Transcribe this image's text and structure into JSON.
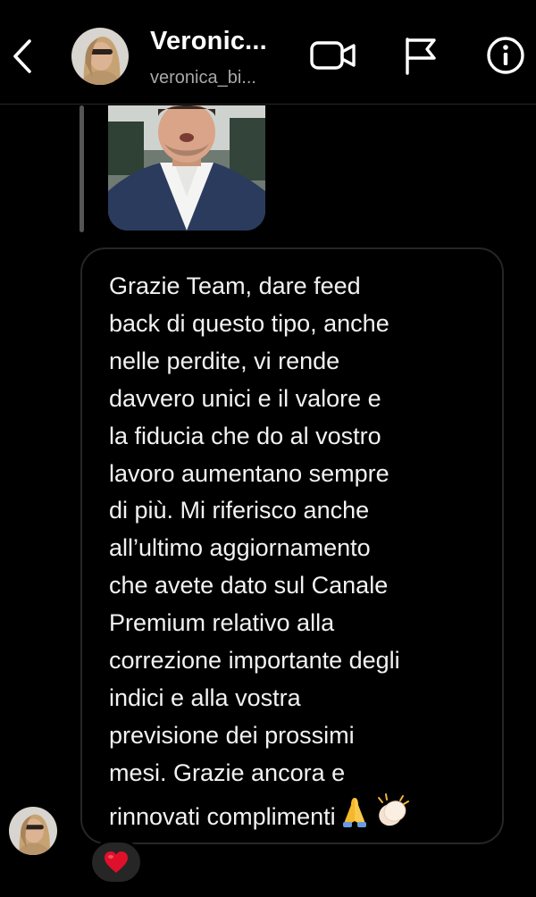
{
  "header": {
    "display_name": "Veronic...",
    "username": "veronica_bi...",
    "icons": [
      "back-chevron-icon",
      "video-call-icon",
      "flag-icon",
      "info-icon"
    ]
  },
  "reply_preview": {
    "media": "video-thumbnail-man-in-suit"
  },
  "message": {
    "text": "Grazie Team, dare feed\nback di questo tipo, anche\nnelle perdite, vi rende\ndavvero unici e il valore  e\nla fiducia che do al vostro\nlavoro aumentano sempre\ndi più. Mi riferisco anche\nall’ultimo aggiornamento\nche avete dato sul Canale\nPremium relativo alla\ncorrezione importante degli\nindici e alla vostra\nprevisione dei prossimi\nmesi. Grazie ancora e\nrinnovati complimenti",
    "trailing_emojis": [
      "folded-hands-emoji",
      "clapping-hands-emoji"
    ]
  },
  "reaction": {
    "emoji": "red-heart-emoji"
  },
  "colors": {
    "background": "#000000",
    "bubble_border": "#262626",
    "secondary_text": "#a8a8a8",
    "heart": "#e0102b"
  }
}
